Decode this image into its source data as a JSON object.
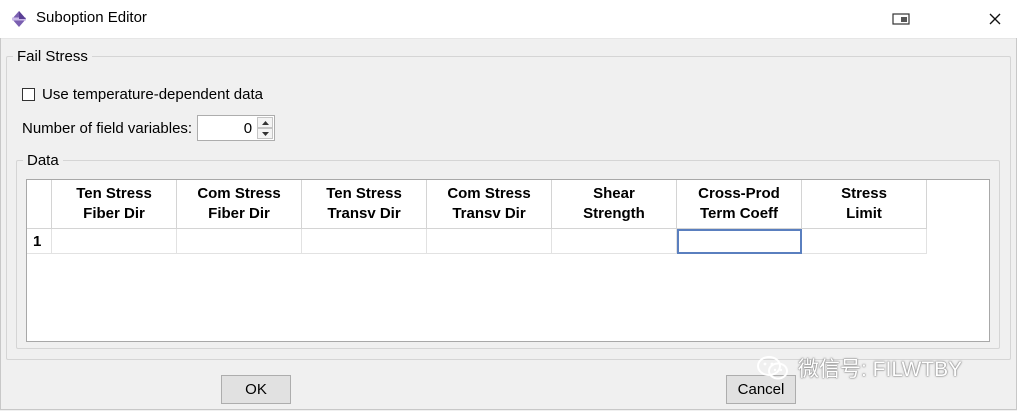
{
  "window": {
    "title": "Suboption Editor"
  },
  "fail_stress": {
    "legend": "Fail Stress",
    "temp_dependent_label": "Use temperature-dependent data",
    "temp_dependent_checked": false,
    "field_vars_label": "Number of field variables:",
    "field_vars_value": "0"
  },
  "data": {
    "legend": "Data",
    "columns": [
      [
        "Ten Stress",
        "Fiber Dir"
      ],
      [
        "Com Stress",
        "Fiber Dir"
      ],
      [
        "Ten Stress",
        "Transv Dir"
      ],
      [
        "Com Stress",
        "Transv Dir"
      ],
      [
        "Shear",
        "Strength"
      ],
      [
        "Cross-Prod",
        "Term Coeff"
      ],
      [
        "Stress",
        "Limit"
      ]
    ],
    "rows": [
      {
        "label": "1",
        "cells": [
          "",
          "",
          "",
          "",
          "",
          "",
          ""
        ]
      }
    ],
    "selected_column": 5
  },
  "buttons": {
    "ok": "OK",
    "cancel": "Cancel"
  },
  "watermark": {
    "text": "微信号: FILWTBY"
  }
}
